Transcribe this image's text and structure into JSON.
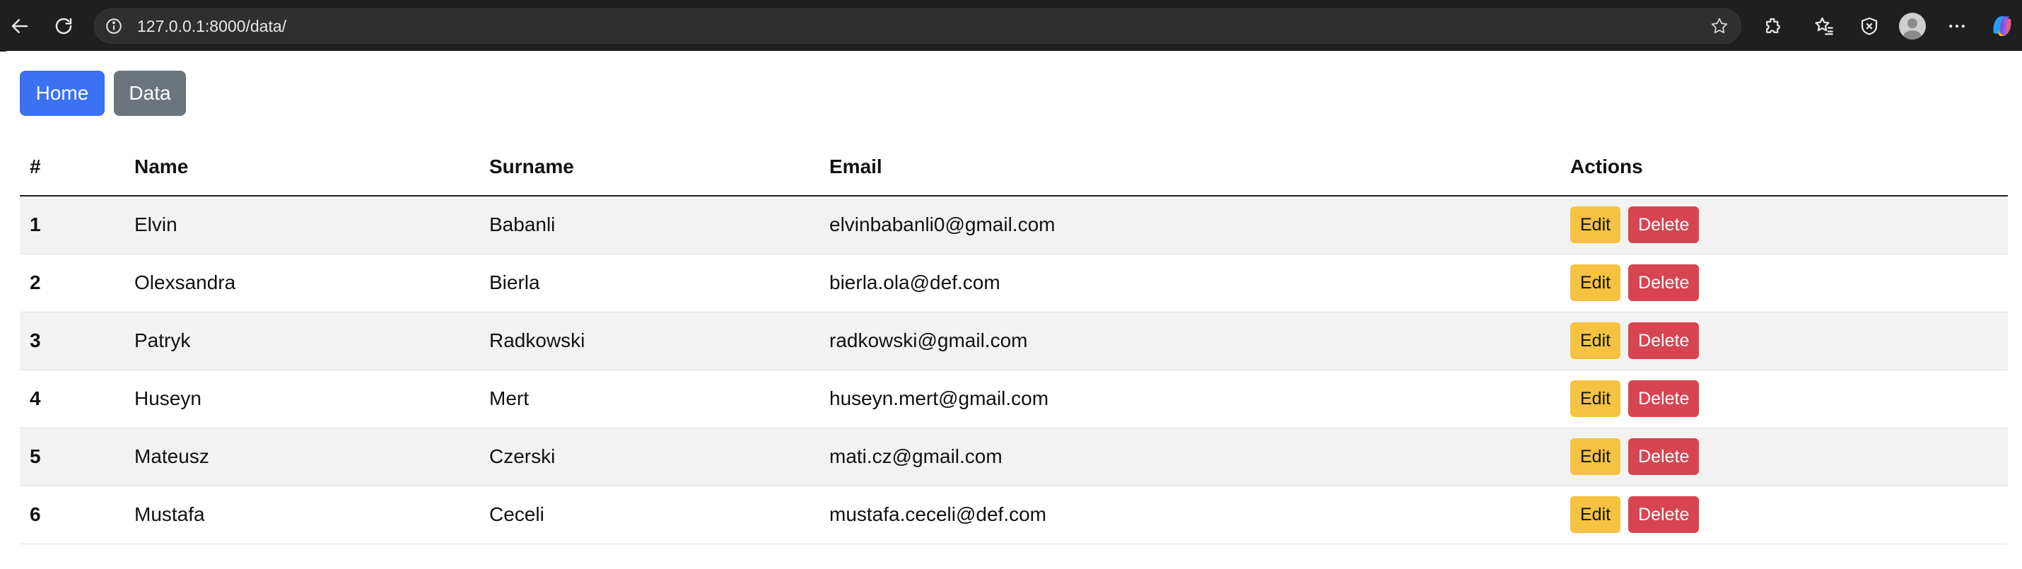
{
  "browser": {
    "url": "127.0.0.1:8000/data/",
    "icons": [
      "back-arrow-icon",
      "refresh-icon",
      "info-icon",
      "star-icon",
      "extensions-icon",
      "favorites-icon",
      "shield-icon",
      "avatar",
      "more-icon",
      "copilot-icon"
    ]
  },
  "nav": {
    "home_label": "Home",
    "data_label": "Data",
    "home_color": "#3b71f3",
    "data_color": "#6c757d"
  },
  "table": {
    "headers": [
      "#",
      "Name",
      "Surname",
      "Email",
      "Actions"
    ],
    "rows": [
      {
        "num": "1",
        "name": "Elvin",
        "surname": "Babanli",
        "email": "elvinbabanli0@gmail.com"
      },
      {
        "num": "2",
        "name": "Olexsandra",
        "surname": "Bierla",
        "email": "bierla.ola@def.com"
      },
      {
        "num": "3",
        "name": "Patryk",
        "surname": "Radkowski",
        "email": "radkowski@gmail.com"
      },
      {
        "num": "4",
        "name": "Huseyn",
        "surname": "Mert",
        "email": "huseyn.mert@gmail.com"
      },
      {
        "num": "5",
        "name": "Mateusz",
        "surname": "Czerski",
        "email": "mati.cz@gmail.com"
      },
      {
        "num": "6",
        "name": "Mustafa",
        "surname": "Ceceli",
        "email": "mustafa.ceceli@def.com"
      }
    ],
    "edit_label": "Edit",
    "delete_label": "Delete",
    "edit_color": "#f5c242",
    "delete_color": "#d64550"
  }
}
